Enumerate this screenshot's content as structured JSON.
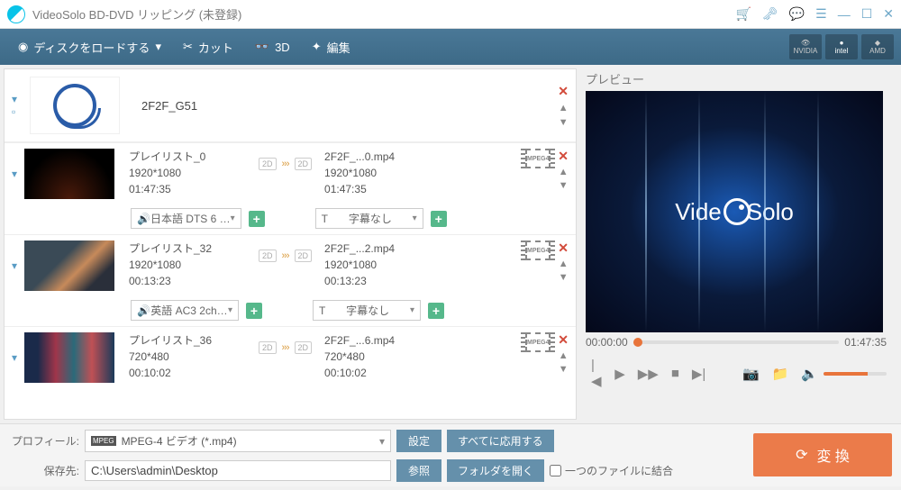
{
  "title": "VideoSolo BD-DVD リッピング (未登録)",
  "toolbar": {
    "load_disc": "ディスクをロードする",
    "cut": "カット",
    "threed": "3D",
    "edit": "編集"
  },
  "gpu": {
    "nvidia": "NVIDIA",
    "intel": "intel",
    "amd": "AMD"
  },
  "disc": {
    "title": "2F2F_G51"
  },
  "items": [
    {
      "name": "プレイリスト_0",
      "src_res": "1920*1080",
      "src_dur": "01:47:35",
      "dst_name": "2F2F_...0.mp4",
      "dst_res": "1920*1080",
      "dst_dur": "01:47:35",
      "audio": "日本語 DTS 6 …",
      "subtitle": "字幕なし",
      "fmt_label": "MPEG4",
      "thumb_class": "thumb0"
    },
    {
      "name": "プレイリスト_32",
      "src_res": "1920*1080",
      "src_dur": "00:13:23",
      "dst_name": "2F2F_...2.mp4",
      "dst_res": "1920*1080",
      "dst_dur": "00:13:23",
      "audio": "英語 AC3 2ch…",
      "subtitle": "字幕なし",
      "fmt_label": "MPEG4",
      "thumb_class": "thumb1"
    },
    {
      "name": "プレイリスト_36",
      "src_res": "720*480",
      "src_dur": "00:10:02",
      "dst_name": "2F2F_...6.mp4",
      "dst_res": "720*480",
      "dst_dur": "00:10:02",
      "audio": "",
      "subtitle": "",
      "fmt_label": "MPEG4",
      "thumb_class": "thumb2"
    }
  ],
  "src_badge": "2D",
  "dst_badge": "2D",
  "preview": {
    "label": "プレビュー",
    "logo_pre": "Vide",
    "logo_post": "olo",
    "current": "00:00:00",
    "total": "01:47:35"
  },
  "footer": {
    "profile_label": "プロフィール:",
    "profile_value": "MPEG-4 ビデオ (*.mp4)",
    "mpeg_badge": "MPEG",
    "settings": "設定",
    "apply_all": "すべてに応用する",
    "dest_label": "保存先:",
    "dest_value": "C:\\Users\\admin\\Desktop",
    "browse": "参照",
    "open_folder": "フォルダを開く",
    "merge": "一つのファイルに結合",
    "convert": "変 換"
  }
}
